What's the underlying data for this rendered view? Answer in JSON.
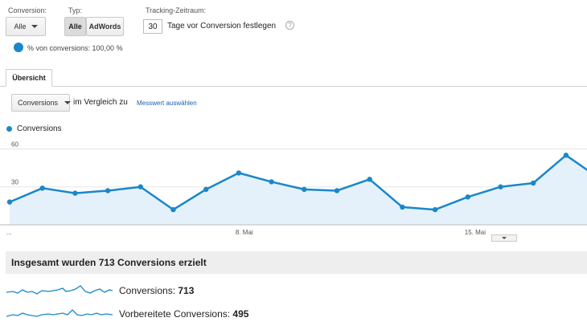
{
  "filters": {
    "conversion_label": "Conversion:",
    "conversion_value": "Alle",
    "type_label": "Typ:",
    "type_options": [
      "Alle",
      "AdWords"
    ],
    "tracking_label": "Tracking-Zeitraum:",
    "tracking_value": "30",
    "tracking_suffix": "Tage vor Conversion festlegen",
    "help": "?",
    "percent_text": "% von conversions: 100,00 %"
  },
  "tabs": [
    {
      "label": "Übersicht"
    }
  ],
  "compare": {
    "metric_select": "Conversions",
    "compare_text": "im Vergleich zu",
    "choose_link": "Messwert auswählen"
  },
  "chart_data": {
    "type": "area",
    "series": [
      {
        "name": "Conversions",
        "values": [
          18,
          29,
          25,
          27,
          30,
          12,
          28,
          41,
          34,
          28,
          27,
          36,
          14,
          12,
          22,
          30,
          33,
          55,
          37
        ]
      }
    ],
    "ylim": [
      0,
      66
    ],
    "y_ticks": [
      {
        "value": 30,
        "label": "30"
      },
      {
        "value": 60,
        "label": "60"
      }
    ],
    "x_ticks": [
      {
        "index": 0,
        "label": "..."
      },
      {
        "index": 7,
        "label": "8. Mai"
      },
      {
        "index": 14,
        "label": "15. Mai"
      }
    ],
    "grid": true,
    "line_color": "#1a87c9",
    "fill_color": "#e5f1fa"
  },
  "summary": {
    "total_text": "Insgesamt wurden 713 Conversions erzielt",
    "metrics": [
      {
        "label": "Conversions: ",
        "value": "713"
      },
      {
        "label": "Vorbereitete Conversions: ",
        "value": "495"
      }
    ]
  }
}
